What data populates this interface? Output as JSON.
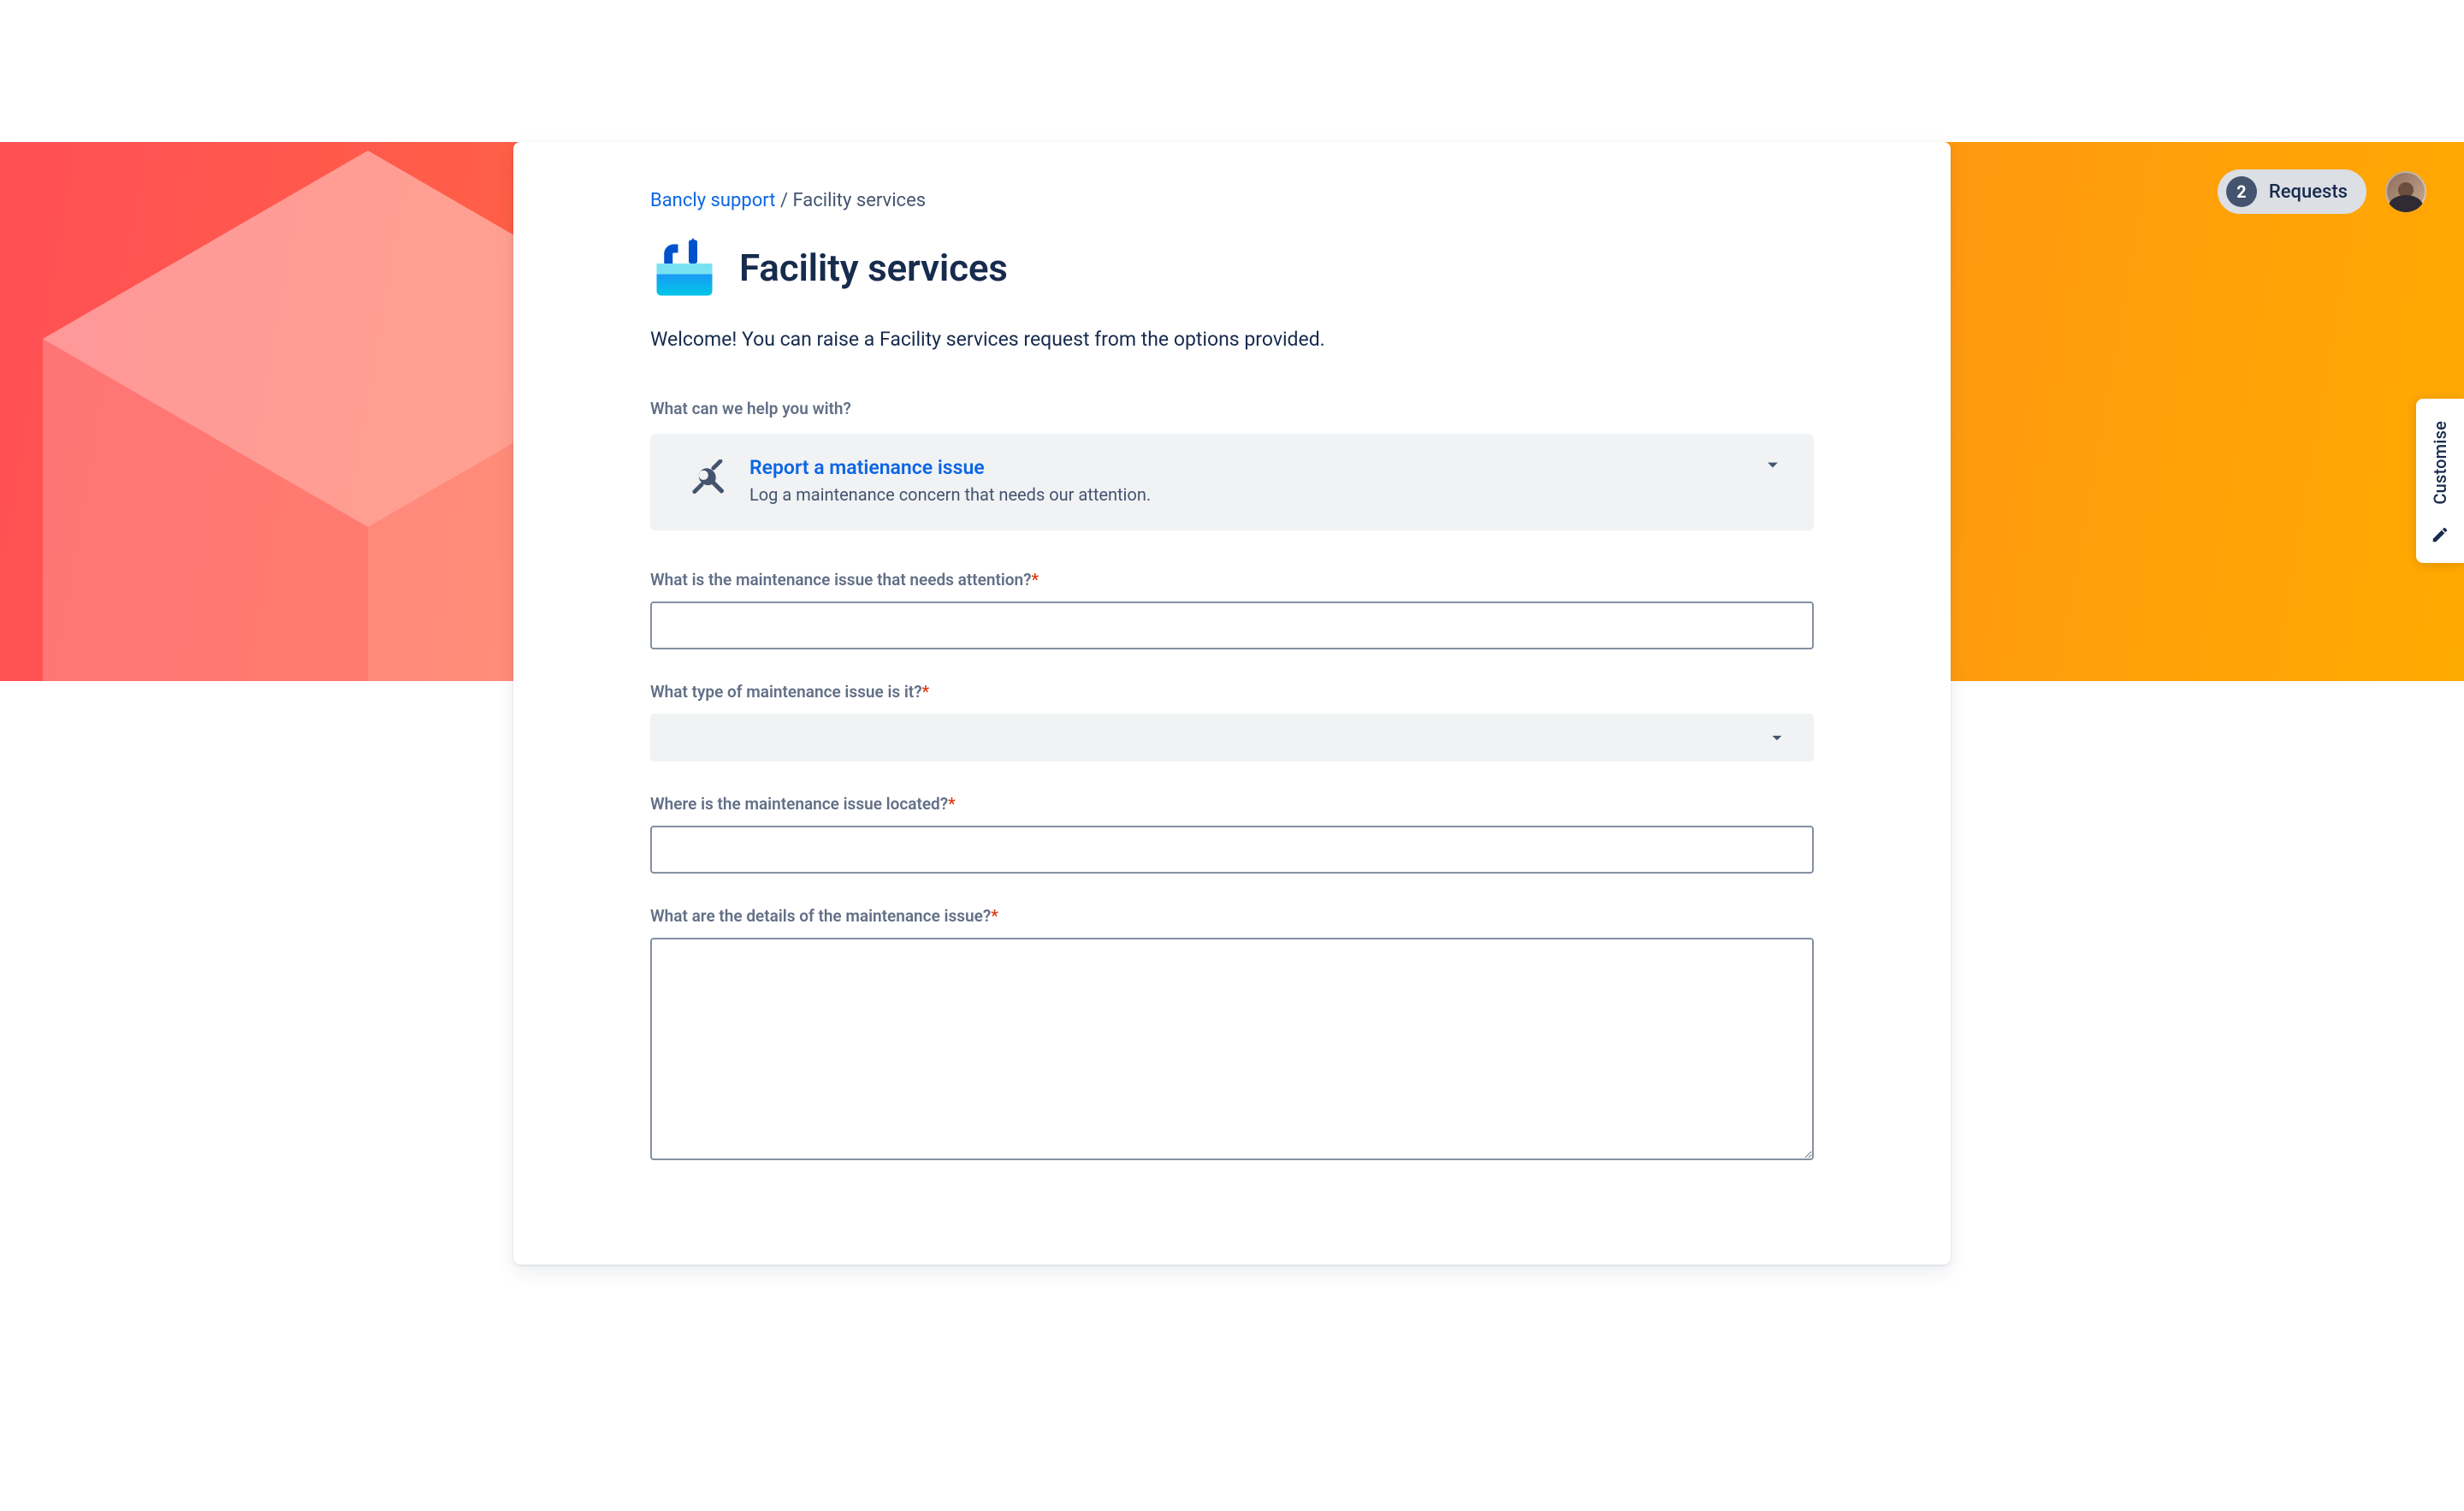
{
  "header": {
    "requests_count": "2",
    "requests_label": "Requests"
  },
  "customise": {
    "label": "Customise"
  },
  "breadcrumb": {
    "root": "Bancly support",
    "separator": " / ",
    "current": "Facility services"
  },
  "title": "Facility services",
  "welcome": "Welcome! You can raise a Facility services request from the options provided.",
  "help_prompt": "What can we help you with?",
  "request_type": {
    "title": "Report a matienance issue",
    "description": "Log a maintenance concern that needs our attention."
  },
  "fields": {
    "issue_summary": {
      "label": "What is the maintenance issue that needs attention?",
      "required": true,
      "value": ""
    },
    "issue_type": {
      "label": "What type of maintenance issue is it?",
      "required": true,
      "value": ""
    },
    "issue_location": {
      "label": "Where is the maintenance issue located?",
      "required": true,
      "value": ""
    },
    "issue_details": {
      "label": "What are the details of the maintenance issue?",
      "required": true,
      "value": ""
    }
  }
}
